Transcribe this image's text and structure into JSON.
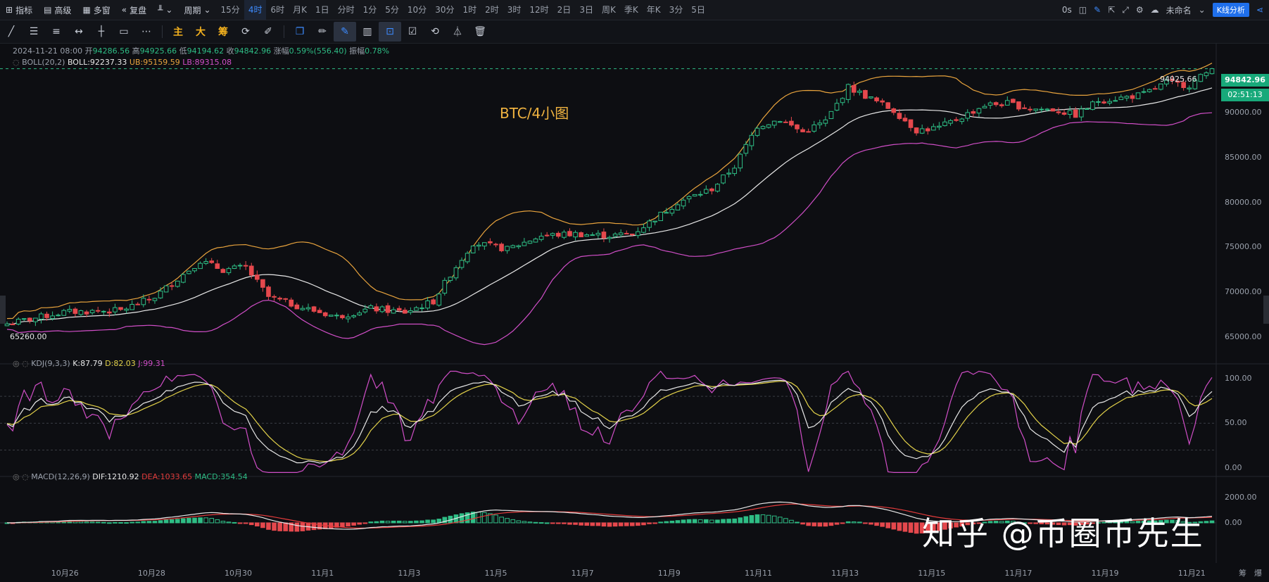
{
  "toolbar": {
    "indicators": "指标",
    "advanced": "高级",
    "multi_window": "多窗",
    "replay": "复盘",
    "period": "周期",
    "timeframes": [
      "15分",
      "4时",
      "6时",
      "月K",
      "1日",
      "分时",
      "1分",
      "5分",
      "10分",
      "30分",
      "1时",
      "2时",
      "3时",
      "12时",
      "2日",
      "3日",
      "周K",
      "季K",
      "年K",
      "3分",
      "5日"
    ],
    "active_timeframe": "4时",
    "latency": "0s",
    "layout_name": "未命名",
    "analysis_button": "K线分析"
  },
  "drawing_tools": {
    "main": "主",
    "big": "大",
    "chip": "筹"
  },
  "ohlc": {
    "date": "2024-11-21 08:00",
    "open_label": "开",
    "open": "94286.56",
    "high_label": "高",
    "high": "94925.66",
    "low_label": "低",
    "low": "94194.62",
    "close_label": "收",
    "close": "94842.96",
    "change_label": "涨幅",
    "change": "0.59%(556.40)",
    "amp_label": "振幅",
    "amp": "0.78%"
  },
  "boll": {
    "name": "BOLL(20,2)",
    "boll": "BOLL:92237.33",
    "ub": "UB:95159.59",
    "lb": "LB:89315.08"
  },
  "kdj": {
    "name": "KDJ(9,3,3)",
    "k": "K:87.79",
    "d": "D:82.03",
    "j": "J:99.31"
  },
  "macd": {
    "name": "MACD(12,26,9)",
    "dif": "DIF:1210.92",
    "dea": "DEA:1033.65",
    "macd": "MACD:354.54"
  },
  "chart_title": "BTC/4小图",
  "price_axis": [
    "90000.00",
    "85000.00",
    "80000.00",
    "75000.00",
    "70000.00",
    "65000.00"
  ],
  "kdj_axis": [
    "100.00",
    "50.00",
    "0.00"
  ],
  "macd_axis": [
    "2000.00",
    "0.00"
  ],
  "current_price": "94842.96",
  "countdown": "02:51:13",
  "high_marker": "94925.66",
  "low_marker": "65260.00",
  "x_axis": [
    "10月26",
    "10月28",
    "10月30",
    "11月1",
    "11月3",
    "11月5",
    "11月7",
    "11月9",
    "11月11",
    "11月13",
    "11月15",
    "11月17",
    "11月19",
    "11月21"
  ],
  "corner_labels": [
    "筹",
    "爆"
  ],
  "watermark": "知乎 @币圈币先生",
  "chart_data": {
    "type": "candlestick",
    "title": "BTC/4小图",
    "x_ticks": [
      "10月26",
      "10月28",
      "10月30",
      "11月1",
      "11月3",
      "11月5",
      "11月7",
      "11月9",
      "11月11",
      "11月13",
      "11月15",
      "11月17",
      "11月19",
      "11月21"
    ],
    "ylim": [
      63000,
      97000
    ],
    "price_anchors": [
      [
        0,
        66500
      ],
      [
        10,
        67800
      ],
      [
        20,
        68000
      ],
      [
        26,
        69500
      ],
      [
        30,
        71500
      ],
      [
        34,
        73500
      ],
      [
        38,
        72500
      ],
      [
        42,
        72800
      ],
      [
        46,
        69500
      ],
      [
        52,
        68300
      ],
      [
        58,
        67300
      ],
      [
        64,
        68200
      ],
      [
        70,
        67800
      ],
      [
        75,
        69000
      ],
      [
        78,
        72000
      ],
      [
        82,
        75500
      ],
      [
        88,
        74800
      ],
      [
        94,
        76300
      ],
      [
        100,
        76500
      ],
      [
        106,
        76300
      ],
      [
        110,
        76500
      ],
      [
        114,
        78200
      ],
      [
        118,
        80000
      ],
      [
        124,
        81500
      ],
      [
        128,
        84000
      ],
      [
        132,
        88500
      ],
      [
        136,
        89200
      ],
      [
        140,
        87800
      ],
      [
        144,
        89000
      ],
      [
        148,
        92800
      ],
      [
        152,
        91500
      ],
      [
        156,
        90200
      ],
      [
        160,
        88000
      ],
      [
        164,
        88300
      ],
      [
        168,
        89500
      ],
      [
        172,
        90800
      ],
      [
        176,
        91000
      ],
      [
        180,
        90400
      ],
      [
        184,
        90300
      ],
      [
        188,
        89700
      ],
      [
        192,
        91300
      ],
      [
        196,
        91600
      ],
      [
        200,
        92000
      ],
      [
        204,
        93300
      ],
      [
        208,
        93000
      ],
      [
        212,
        94842.96
      ]
    ],
    "kdj_ylim": [
      0,
      110
    ],
    "macd_ylim": [
      -2600,
      3200
    ],
    "series": [
      {
        "name": "BOLL",
        "color": "#e8e8e8"
      },
      {
        "name": "UB",
        "color": "#e8a33d"
      },
      {
        "name": "LB",
        "color": "#d04ec7"
      },
      {
        "name": "K",
        "color": "#e8e8e8"
      },
      {
        "name": "D",
        "color": "#e3d24a"
      },
      {
        "name": "J",
        "color": "#d04ec7"
      },
      {
        "name": "DIF",
        "color": "#e8e8e8"
      },
      {
        "name": "DEA",
        "color": "#e23b3b"
      }
    ],
    "up_color": "#2ebd85",
    "down_color": "#e5484d"
  }
}
